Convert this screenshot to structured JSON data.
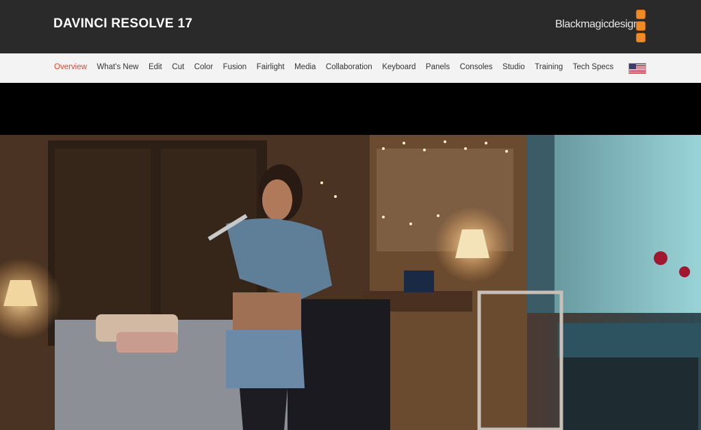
{
  "header": {
    "product_title": "DAVINCI RESOLVE 17",
    "logo_text": "Blackmagicdesign"
  },
  "nav": {
    "items": [
      {
        "label": "Overview",
        "active": true
      },
      {
        "label": "What's New"
      },
      {
        "label": "Edit"
      },
      {
        "label": "Cut"
      },
      {
        "label": "Color"
      },
      {
        "label": "Fusion"
      },
      {
        "label": "Fairlight"
      },
      {
        "label": "Media"
      },
      {
        "label": "Collaboration"
      },
      {
        "label": "Keyboard"
      },
      {
        "label": "Panels"
      },
      {
        "label": "Consoles"
      },
      {
        "label": "Studio"
      },
      {
        "label": "Training"
      },
      {
        "label": "Tech Specs"
      }
    ],
    "region_flag": "us-flag-icon"
  },
  "colors": {
    "header_bg": "#2a2a2a",
    "nav_bg": "#f3f3f3",
    "active_nav": "#e8452c",
    "logo_accent": "#f08a24"
  }
}
